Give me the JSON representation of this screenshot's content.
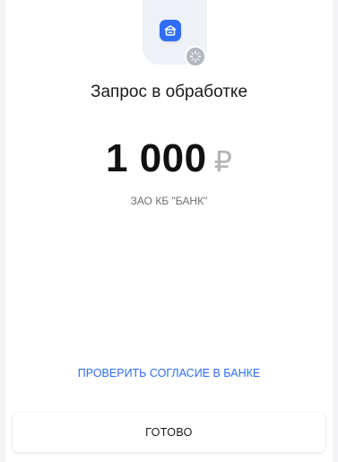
{
  "status": {
    "title": "Запрос в обработке",
    "bank_icon": "bank-building-icon",
    "badge_icon": "loading-spinner-icon"
  },
  "payment": {
    "amount": "1 000",
    "currency_symbol": "₽",
    "bank_name": "ЗАО КБ \"БАНК\""
  },
  "actions": {
    "check_consent_label": "ПРОВЕРИТЬ СОГЛАСИЕ В БАНКЕ",
    "done_label": "ГОТОВО"
  },
  "colors": {
    "accent": "#2f6df6",
    "badge": "#b4b8c0",
    "currency": "#b5b5b8",
    "muted_text": "#6e6e73"
  }
}
